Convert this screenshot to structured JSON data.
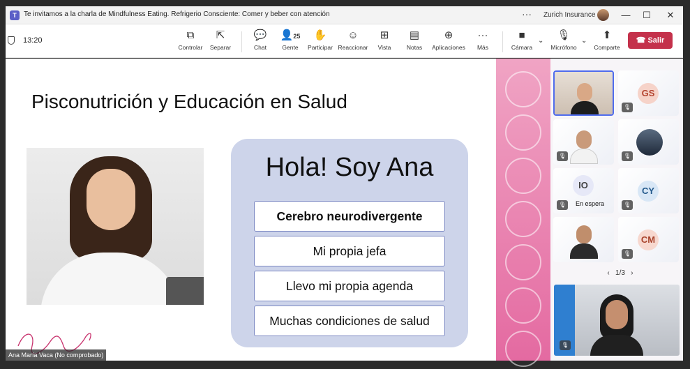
{
  "window": {
    "title": "Te invitamos a la charla de Mindfulness Eating. Refrigerio Consciente: Comer y beber con atención",
    "org": "Zurich Insurance",
    "more_glyph": "···",
    "minimize_glyph": "—",
    "maximize_glyph": "☐",
    "close_glyph": "✕"
  },
  "meeting": {
    "time": "13:20"
  },
  "toolbar": {
    "controls_label": "Controlar",
    "separate_label": "Separar",
    "chat_label": "Chat",
    "people_label": "Gente",
    "people_count": "25",
    "participate_label": "Participar",
    "react_label": "Reaccionar",
    "view_label": "Vista",
    "notes_label": "Notas",
    "apps_label": "Aplicaciones",
    "more_label": "Más",
    "camera_label": "Cámara",
    "mic_label": "Micrófono",
    "share_label": "Comparte",
    "leave_label": "Salir"
  },
  "slide": {
    "title": "Pisconutrición y Educación en Salud",
    "heading": "Hola! Soy Ana",
    "points": [
      "Cerebro neurodivergente",
      "Mi propia jefa",
      "Llevo mi propia agenda",
      "Muchas condiciones de salud"
    ]
  },
  "presenter": {
    "name_tag": "Ana María Vaca (No comprobado)"
  },
  "participants": {
    "tiles": [
      {
        "initials": "GS"
      },
      {
        "initials": "IO",
        "status": "En espera"
      },
      {
        "initials": "CY"
      },
      {
        "initials": "CM"
      }
    ],
    "pager": "1/3",
    "prev_glyph": "‹",
    "next_glyph": "›"
  },
  "colors": {
    "leave": "#c4314b",
    "accent": "#4f6bed",
    "card": "#cdd4ea",
    "strip": "#e46aa1"
  }
}
